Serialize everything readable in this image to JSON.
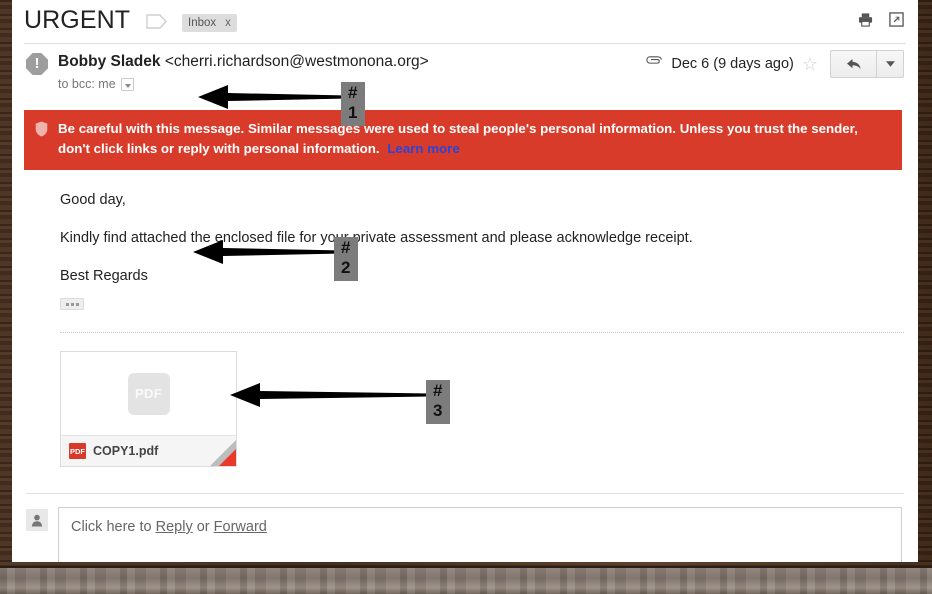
{
  "window": {
    "frame_color": "#3b2415",
    "plank_color": "#8e8279"
  },
  "header": {
    "subject": "URGENT",
    "label_tag_icon": "label-tag-icon",
    "inbox_chip": {
      "label": "Inbox",
      "close": "x"
    },
    "actions": [
      {
        "name": "print-icon",
        "glyph": "print"
      },
      {
        "name": "open-in-new-window-icon",
        "glyph": "popout"
      }
    ]
  },
  "message": {
    "avatar_icon": "warning-avatar-icon",
    "avatar_glyph": "!",
    "sender_name": "Bobby Sladek",
    "sender_email": "<cherri.richardson@westmonona.org>",
    "recipient": "to bcc: me",
    "attachment_indicator_icon": "paperclip-icon",
    "date": "Dec 6 (9 days ago)",
    "star_icon": "star-icon",
    "star_glyph": "☆",
    "reply_icon": "reply-arrow-icon",
    "reply_more_icon": "chevron-down-icon"
  },
  "warning": {
    "icon": "shield-warning-icon",
    "bold_text": "Be careful with this message.",
    "body_text": "Similar messages were used to steal people's personal information. Unless you trust the sender, don't click links or reply with personal information.",
    "link_text": "Learn more",
    "bg_color": "#d93b2b",
    "link_color": "#2a44d6"
  },
  "body": {
    "paragraphs": [
      "Good day,",
      "Kindly find attached the enclosed file for your private assessment and please acknowledge receipt.",
      "Best Regards"
    ],
    "expand_button": "..."
  },
  "attachment": {
    "thumb_label": "PDF",
    "badge_label": "PDF",
    "file_name": "COPY1.pdf",
    "fold_gray": "#bdbdbd",
    "fold_red": "#e8392b"
  },
  "reply": {
    "avatar_icon": "person-icon",
    "prompt_prefix": "Click here to ",
    "reply_link": "Reply",
    "prompt_middle": " or ",
    "forward_link": "Forward"
  },
  "annotations": [
    {
      "name": "annotation-1",
      "label": "# 1"
    },
    {
      "name": "annotation-2",
      "label": "# 2"
    },
    {
      "name": "annotation-3",
      "label": "# 3"
    }
  ]
}
